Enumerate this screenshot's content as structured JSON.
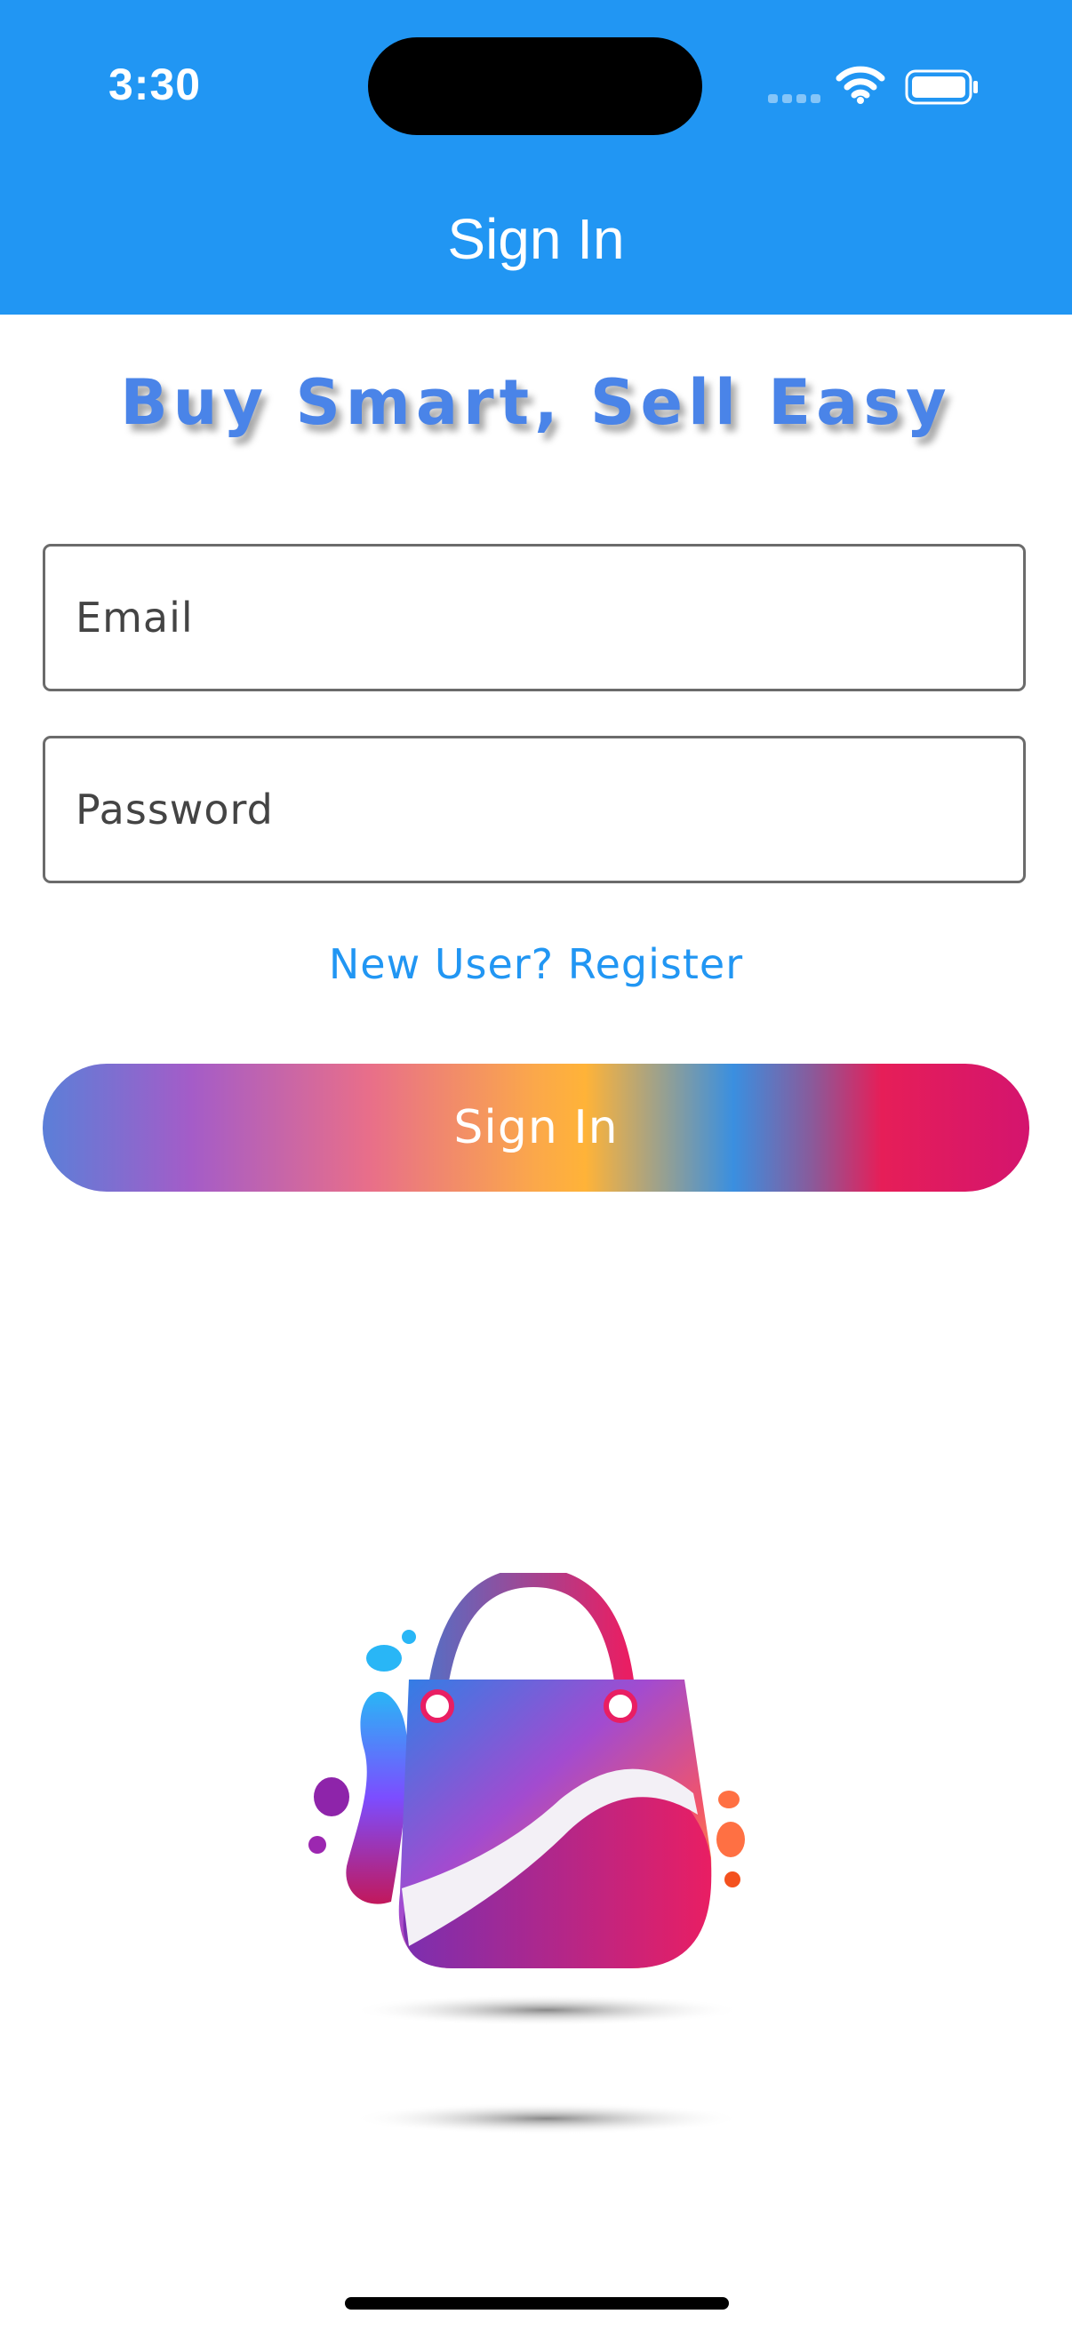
{
  "status_bar": {
    "time": "3:30",
    "wifi_icon": "wifi-icon",
    "battery_icon": "battery-icon",
    "signal_icon": "cellular-signal-icon"
  },
  "header": {
    "title": "Sign In",
    "background_color": "#2196F3"
  },
  "tagline": "Buy Smart, Sell Easy",
  "form": {
    "email_placeholder": "Email",
    "password_placeholder": "Password",
    "register_link": "New User? Register",
    "submit_label": "Sign In"
  },
  "logo": {
    "icon": "shopping-bag-logo"
  },
  "colors": {
    "accent": "#2196F3",
    "tagline": "#4A84E8"
  }
}
